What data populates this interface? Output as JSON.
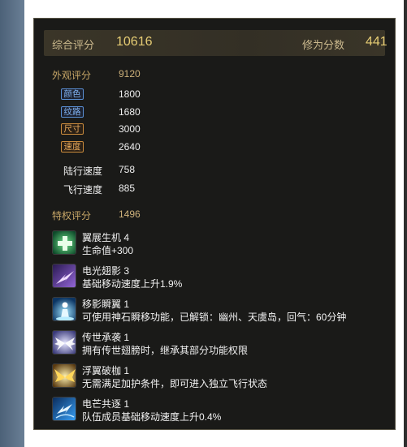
{
  "summary": {
    "total_label": "综合评分",
    "total_value": "10616",
    "cultivation_label": "修为分数",
    "cultivation_value": "441"
  },
  "appearance": {
    "label": "外观评分",
    "value": "9120",
    "stats": [
      {
        "tag": "颜色",
        "value": "1800",
        "color": "blue"
      },
      {
        "tag": "纹路",
        "value": "1680",
        "color": "blue"
      },
      {
        "tag": "尺寸",
        "value": "3000",
        "color": "orange"
      },
      {
        "tag": "速度",
        "value": "2640",
        "color": "orange"
      }
    ]
  },
  "speeds": [
    {
      "label": "陆行速度",
      "value": "758"
    },
    {
      "label": "飞行速度",
      "value": "885"
    }
  ],
  "privilege": {
    "label": "特权评分",
    "value": "1496",
    "perks": [
      {
        "name": "翼展生机 4",
        "desc": "生命值+300",
        "icon": "healing-cross-icon"
      },
      {
        "name": "电光翅影 3",
        "desc": "基础移动速度上升1.9%",
        "icon": "lightning-wing-icon"
      },
      {
        "name": "移影瞬翼 1",
        "desc": "可使用神石瞬移功能，已解锁：幽州、天虞岛，回气：60分钟",
        "icon": "teleport-figure-icon"
      },
      {
        "name": "传世承袭 1",
        "desc": "拥有传世翅膀时，继承其部分功能权限",
        "icon": "inheritance-wing-icon"
      },
      {
        "name": "浮翼破枷 1",
        "desc": "无需满足加护条件，即可进入独立飞行状态",
        "icon": "golden-wings-icon"
      },
      {
        "name": "电芒共逐 1",
        "desc": "队伍成员基础移动速度上升0.4%",
        "icon": "lightning-dash-icon"
      }
    ]
  },
  "colors": {
    "panel_bg": "#1a1a18",
    "gold_text": "#e6cc74",
    "section_label": "#c9a868",
    "tag_blue": "#7fb1f0",
    "tag_orange": "#e7a759"
  }
}
